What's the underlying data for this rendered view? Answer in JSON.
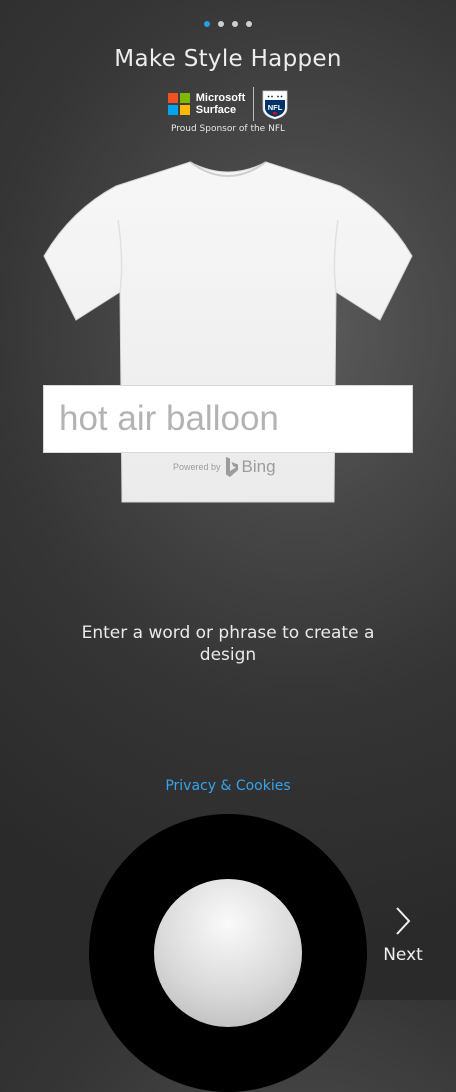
{
  "pager": {
    "total": 4,
    "active_index": 0,
    "active_color": "#2b9be8"
  },
  "header": {
    "title": "Make Style Happen"
  },
  "sponsor": {
    "brand_line1": "Microsoft",
    "brand_line2": "Surface",
    "logo_colors": [
      "#f25022",
      "#7fba00",
      "#00a4ef",
      "#ffb900"
    ],
    "partner_logo": "nfl-shield-icon",
    "caption": "Proud Sponsor of the NFL"
  },
  "design": {
    "text": "hot air balloon",
    "powered_by_label": "Powered by",
    "engine_name": "Bing"
  },
  "instructions": {
    "prompt": "Enter a word or phrase to create a design"
  },
  "links": {
    "privacy": "Privacy & Cookies",
    "privacy_color": "#37a3ee"
  },
  "navigation": {
    "next_label": "Next",
    "next_icon": "chevron-right-icon"
  }
}
